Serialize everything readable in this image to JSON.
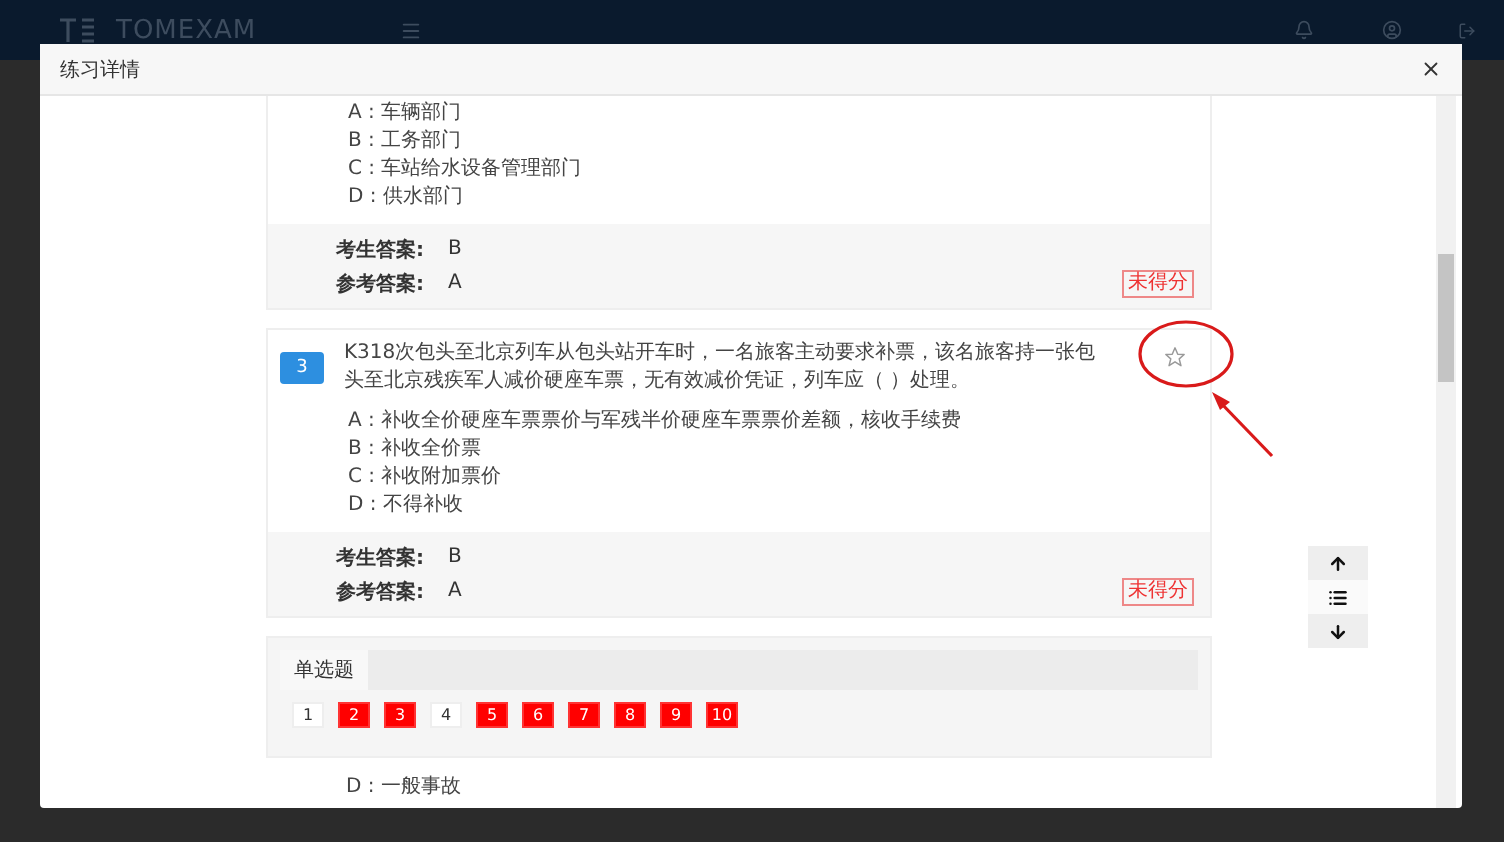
{
  "app_header": {
    "brand": "TOMEXAM"
  },
  "dialog": {
    "title": "练习详情"
  },
  "questions": [
    {
      "options": [
        "A : 车辆部门",
        "B : 工务部门",
        "C : 车站给水设备管理部门",
        "D : 供水部门"
      ],
      "student_label": "考生答案:",
      "student_answer": "B",
      "reference_label": "参考答案:",
      "reference_answer": "A",
      "result": "未得分"
    },
    {
      "number": "3",
      "text": "K318次包头至北京列车从包头站开车时，一名旅客主动要求补票，该名旅客持一张包头至北京残疾军人减价硬座车票，无有效减价凭证，列车应（ ）处理。",
      "starred": false,
      "options": [
        "A : 补收全价硬座车票票价与军残半价硬座车票票价差额，核收手续费",
        "B : 补收全价票",
        "C : 补收附加票价",
        "D : 不得补收"
      ],
      "student_label": "考生答案:",
      "student_answer": "B",
      "reference_label": "参考答案:",
      "reference_answer": "A",
      "result": "未得分"
    }
  ],
  "answer_sheet": {
    "tabs": [
      {
        "label": "单选题",
        "selected": true
      }
    ],
    "items": [
      {
        "label": "1",
        "wrong": false
      },
      {
        "label": "2",
        "wrong": true
      },
      {
        "label": "3",
        "wrong": true
      },
      {
        "label": "4",
        "wrong": false
      },
      {
        "label": "5",
        "wrong": true
      },
      {
        "label": "6",
        "wrong": true
      },
      {
        "label": "7",
        "wrong": true
      },
      {
        "label": "8",
        "wrong": true
      },
      {
        "label": "9",
        "wrong": true
      },
      {
        "label": "10",
        "wrong": true
      }
    ]
  },
  "trailing_option": "D : 一般事故"
}
